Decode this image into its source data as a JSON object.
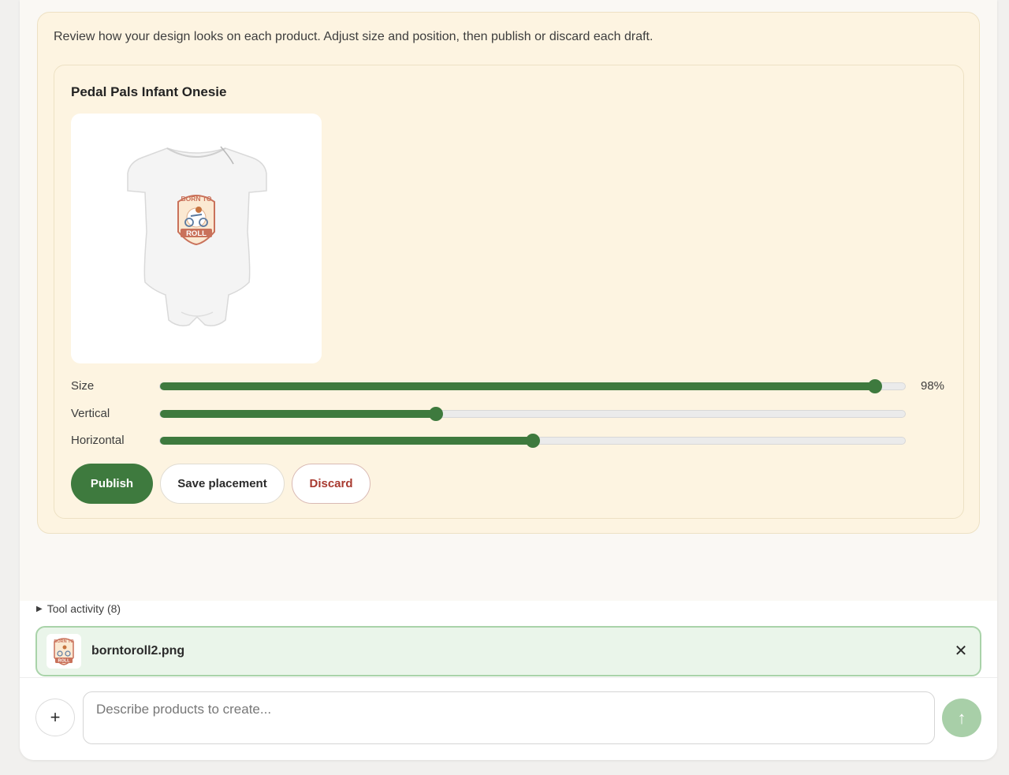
{
  "intro_text": "Review how your design looks on each product. Adjust size and position, then publish or discard each draft.",
  "product": {
    "title": "Pedal Pals Infant Onesie",
    "preview": {
      "item_icon": "onesie-illustration",
      "design_line1": "BORN TO",
      "design_line2": "ROLL"
    },
    "sliders": [
      {
        "label": "Size",
        "value_fraction": 0.96,
        "value_text": "98%"
      },
      {
        "label": "Vertical",
        "value_fraction": 0.37,
        "value_text": ""
      },
      {
        "label": "Horizontal",
        "value_fraction": 0.5,
        "value_text": ""
      }
    ],
    "buttons": {
      "publish": "Publish",
      "save": "Save placement",
      "discard": "Discard"
    }
  },
  "tool_activity": {
    "label": "Tool activity (8)",
    "icon": "triangle-right-icon"
  },
  "attachment": {
    "filename": "borntoroll2.png",
    "thumb_text1": "BORN TO",
    "thumb_text2": "ROLL",
    "close_icon": "close-icon"
  },
  "composer": {
    "placeholder": "Describe products to create...",
    "add_icon": "plus-icon",
    "send_icon": "arrow-up-icon"
  },
  "colors": {
    "accent": "#3e7a3e",
    "panel_bg": "#fdf4e1",
    "discard": "#a83a30",
    "attach_bg": "#eaf5ea",
    "send_bg": "#a8cfa8"
  }
}
